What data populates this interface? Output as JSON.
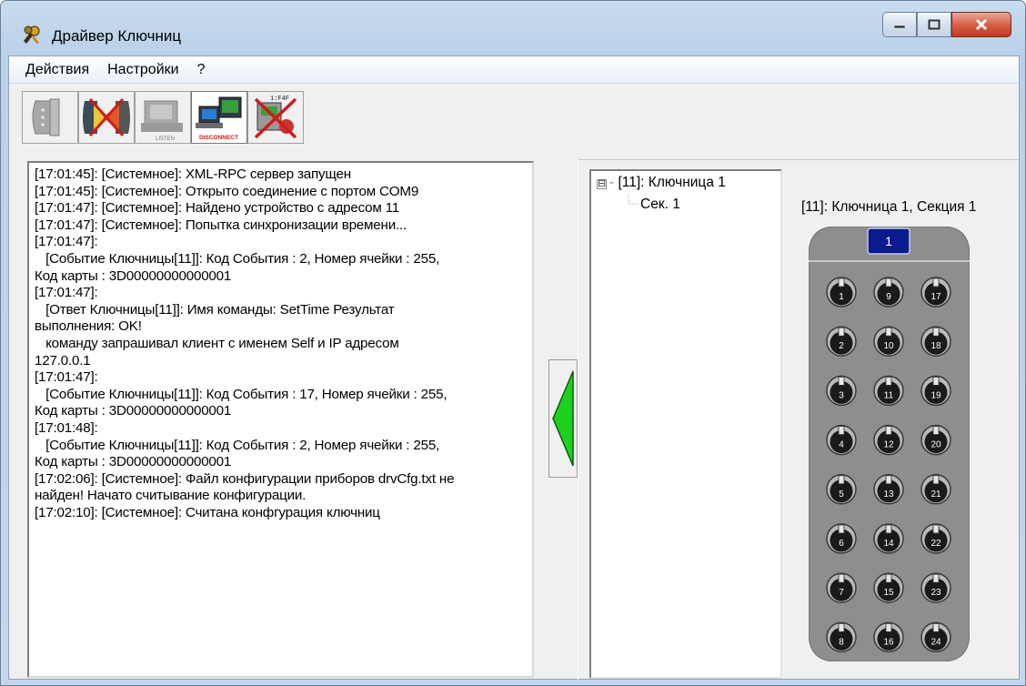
{
  "window": {
    "title": "Драйвер Ключниц",
    "icon": "keys-app-icon",
    "controls": {
      "minimize": "minimize-icon",
      "maximize": "maximize-icon",
      "close": "close-icon"
    }
  },
  "menu": {
    "items": [
      {
        "label": "Действия"
      },
      {
        "label": "Настройки"
      },
      {
        "label": "?"
      }
    ]
  },
  "toolbar": {
    "buttons": [
      {
        "icon": "comport-disabled-icon",
        "tag": ""
      },
      {
        "icon": "comport-disconnect-icon",
        "tag": ""
      },
      {
        "icon": "server-listen-icon",
        "tag": "LISTEN"
      },
      {
        "icon": "computer-disconnect-icon",
        "tag": "DISCONNECT"
      },
      {
        "icon": "device-config-disabled-icon",
        "tag": ""
      }
    ]
  },
  "log": {
    "text": "[17:01:45]: [Системное]: XML-RPC сервер запущен\n[17:01:45]: [Системное]: Открыто соединение с портом COM9\n[17:01:47]: [Системное]: Найдено устройство с адресом 11\n[17:01:47]: [Системное]: Попытка синхронизации времени...\n[17:01:47]:\n   [Событие Ключницы[11]]: Код События : 2, Номер ячейки : 255,\nКод карты : 3D00000000000001\n[17:01:47]:\n   [Ответ Ключницы[11]]: Имя команды: SetTime Результат\nвыполнения: OK!\n   команду запрашивал клиент с именем Self и IP адресом\n127.0.0.1\n[17:01:47]:\n   [Событие Ключницы[11]]: Код События : 17, Номер ячейки : 255,\nКод карты : 3D00000000000001\n[17:01:48]:\n   [Событие Ключницы[11]]: Код События : 2, Номер ячейки : 255,\nКод карты : 3D00000000000001\n[17:02:06]: [Системное]: Файл конфигурации приборов drvCfg.txt не\nнайден! Начато считывание конфигурации.\n[17:02:10]: [Системное]: Считана конфгурация ключниц"
  },
  "collapse_button": {
    "icon": "green-left-arrow-icon",
    "color": "#1fd11f"
  },
  "tree": {
    "expander": "⊟",
    "root": "[11]: Ключница 1",
    "children": [
      "Сек. 1"
    ]
  },
  "cabinet": {
    "title": "[11]: Ключница 1, Секция 1",
    "section_badge": "1",
    "slots": [
      [
        "1",
        "9",
        "17"
      ],
      [
        "2",
        "10",
        "18"
      ],
      [
        "3",
        "11",
        "19"
      ],
      [
        "4",
        "12",
        "20"
      ],
      [
        "5",
        "13",
        "21"
      ],
      [
        "6",
        "14",
        "22"
      ],
      [
        "7",
        "15",
        "23"
      ],
      [
        "8",
        "16",
        "24"
      ]
    ],
    "colors": {
      "body": "#8e8e8e",
      "badge": "#0a1a8c",
      "slot": "#1a1a1a"
    }
  }
}
